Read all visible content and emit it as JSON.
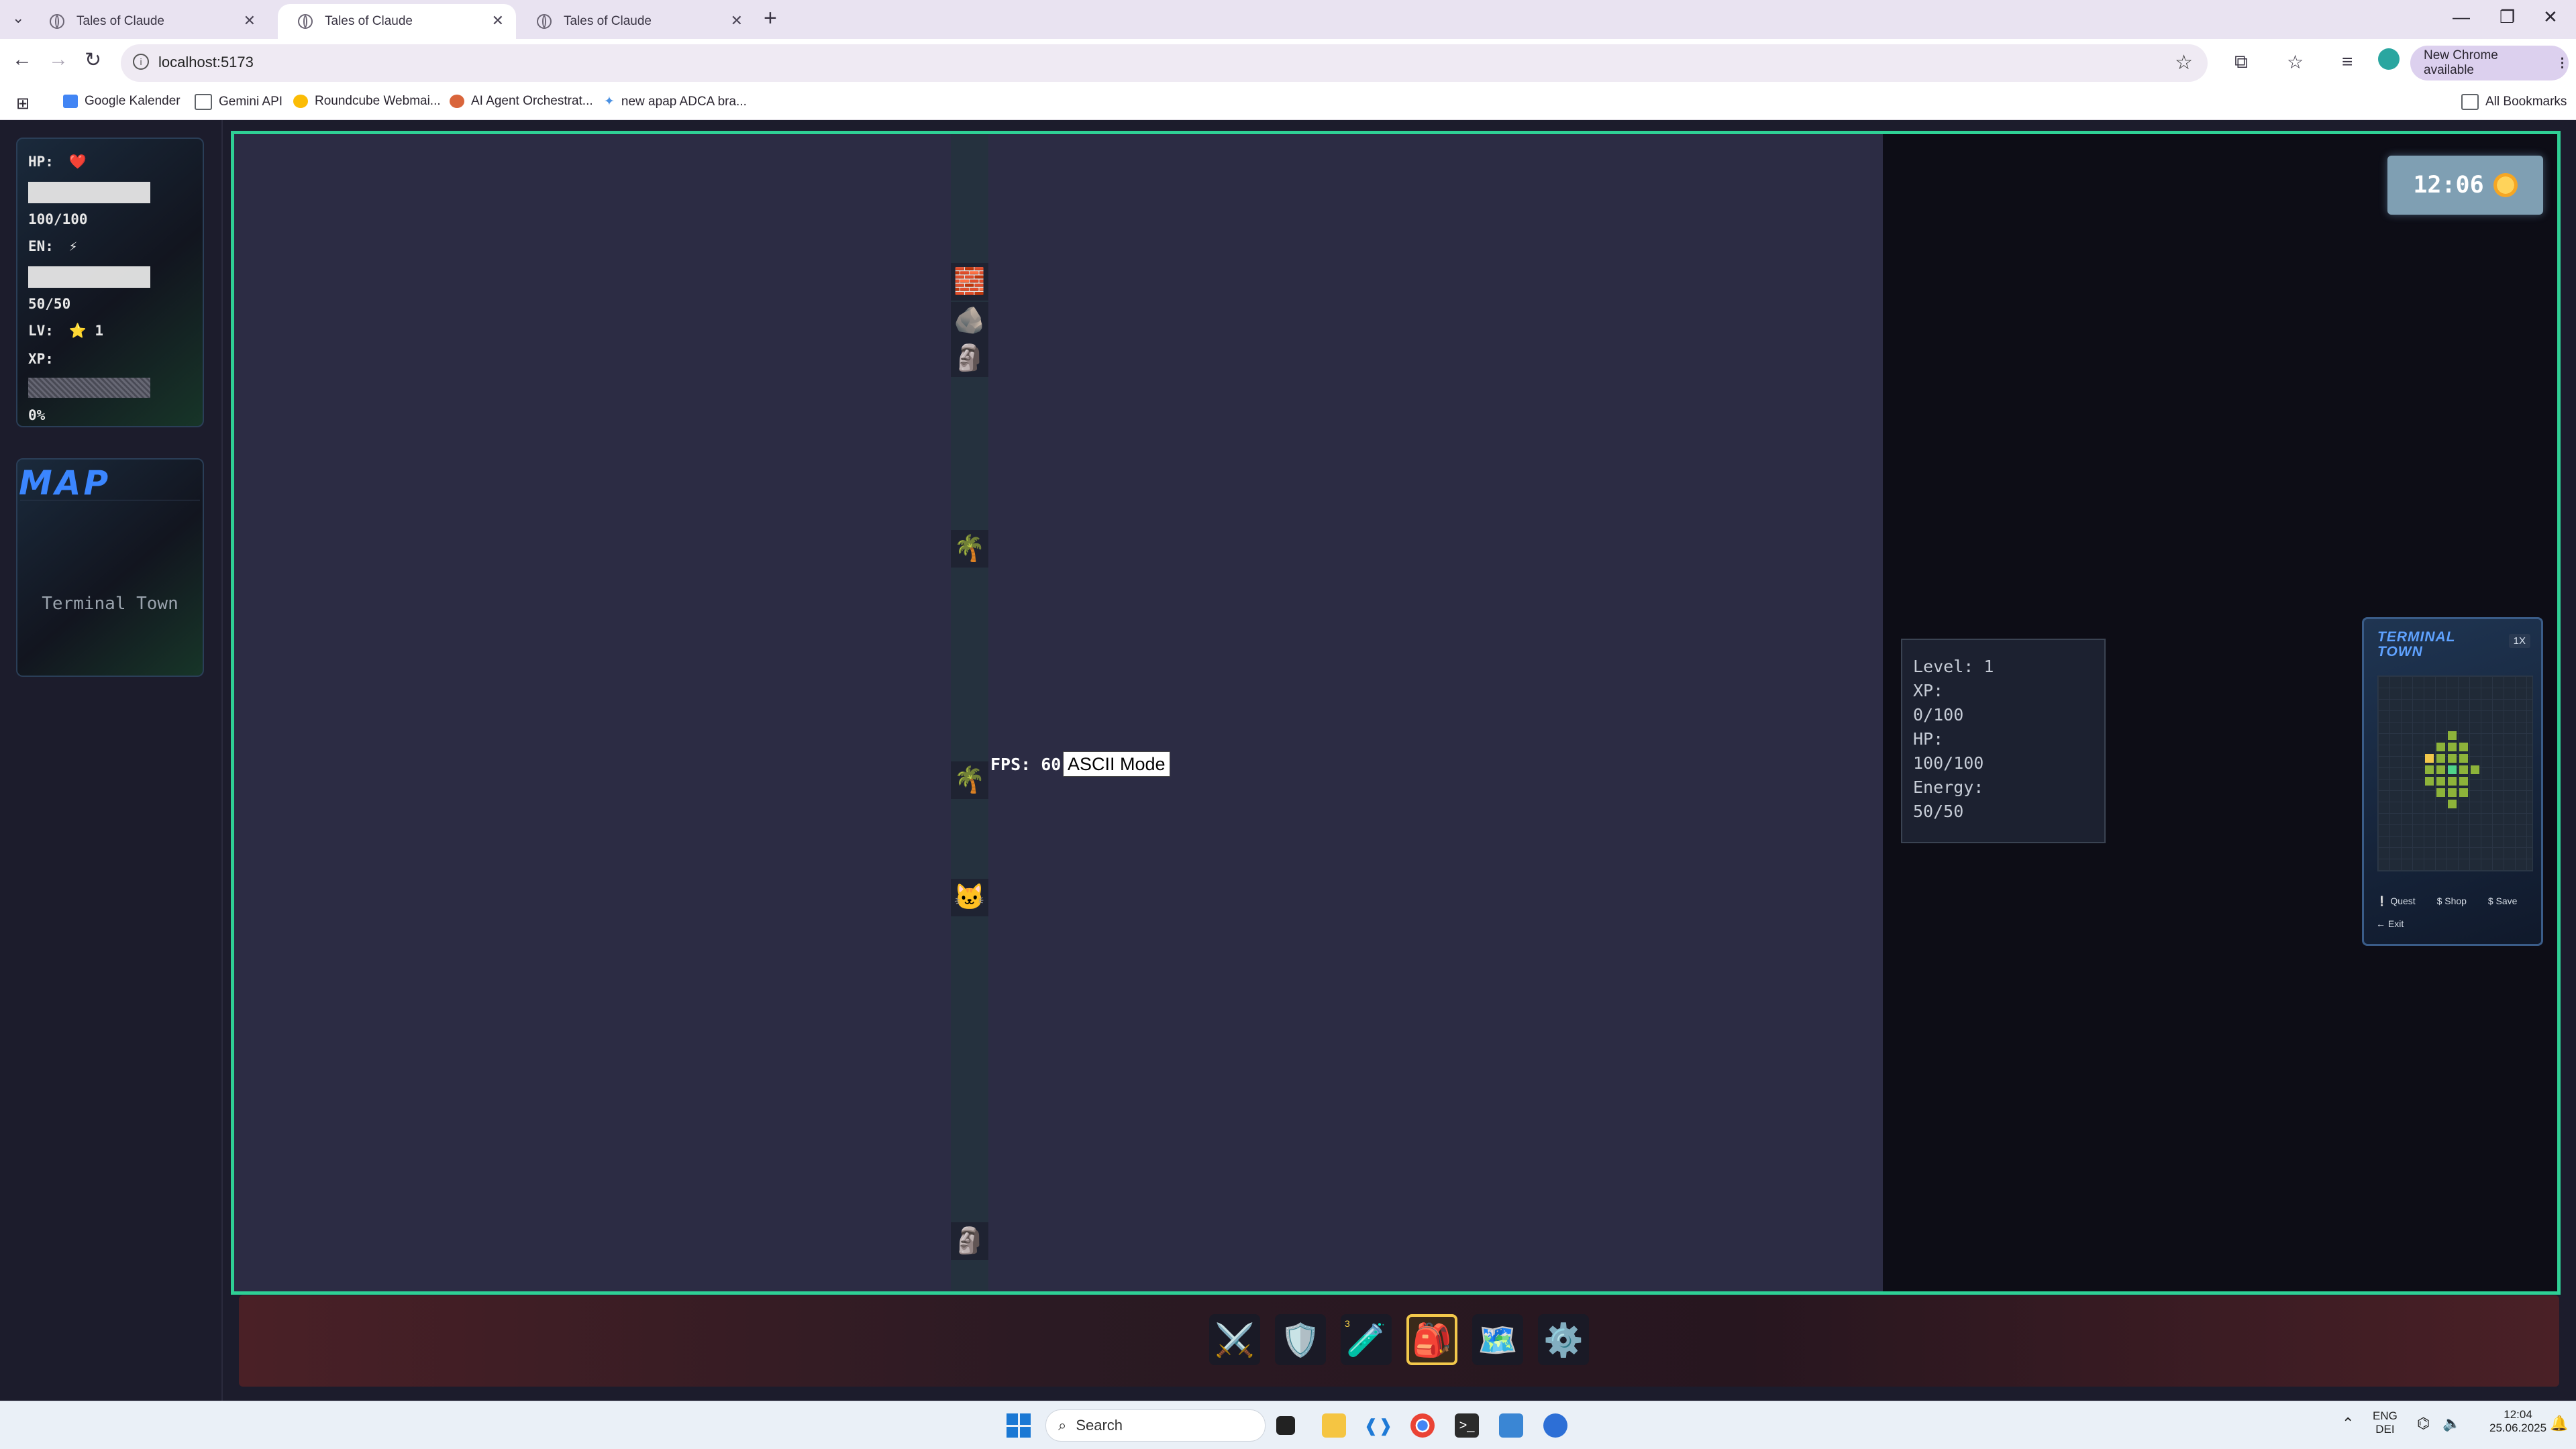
{
  "browser": {
    "tabs": [
      {
        "title": "Tales of Claude",
        "active": false
      },
      {
        "title": "Tales of Claude",
        "active": true
      },
      {
        "title": "Tales of Claude",
        "active": false
      }
    ],
    "new_tab_label": "+",
    "url": "localhost:5173",
    "new_chrome_label": "New Chrome available",
    "bookmarks": [
      {
        "label": "Google Kalender",
        "color": "#4285f4"
      },
      {
        "label": "Gemini API",
        "color": "#5f6368"
      },
      {
        "label": "Roundcube Webmai...",
        "color": "#fbbc05"
      },
      {
        "label": "AI Agent Orchestrat...",
        "color": "#d9653b"
      },
      {
        "label": "new apap ADCA bra...",
        "color": "#4a90e2"
      }
    ],
    "all_bookmarks_label": "All Bookmarks"
  },
  "hud": {
    "hp_label": "HP:",
    "hp_value": "100/100",
    "hp_icon": "❤️",
    "en_label": "EN:",
    "en_value": "50/50",
    "en_icon": "⚡",
    "lv_label": "LV:",
    "lv_icon": "⭐",
    "lv_value": "1",
    "xp_label": "XP:",
    "xp_value": "0%"
  },
  "map_panel": {
    "title": "MAP",
    "location": "Terminal Town"
  },
  "game": {
    "fps_text": "FPS: 60",
    "ascii_button": "ASCII Mode",
    "tiles": {
      "brick": "🧱",
      "rock": "🪨",
      "stone": "🗿",
      "palm": "🌴",
      "cat": "🐱"
    }
  },
  "clock": {
    "time": "12:06"
  },
  "stats_box": {
    "lines": [
      "Level: 1",
      "XP:",
      "0/100",
      "HP:",
      "100/100",
      "Energy:",
      "50/50"
    ]
  },
  "minimap": {
    "title_line1": "TERMINAL",
    "title_line2": "TOWN",
    "zoom": "1X",
    "links": [
      "Quest",
      "Shop",
      "Save",
      "Exit"
    ]
  },
  "hotbar": {
    "slots": [
      {
        "icon": "⚔️",
        "name": "weapons"
      },
      {
        "icon": "🛡️",
        "name": "armor"
      },
      {
        "icon": "🧪",
        "name": "potions",
        "count": "3"
      },
      {
        "icon": "🎒",
        "name": "inventory",
        "active": true
      },
      {
        "icon": "🗺️",
        "name": "map"
      },
      {
        "icon": "⚙️",
        "name": "settings"
      }
    ]
  },
  "taskbar": {
    "search_placeholder": "Search",
    "lang_top": "ENG",
    "lang_bottom": "DEI",
    "time": "12:04",
    "date": "25.06.2025"
  }
}
